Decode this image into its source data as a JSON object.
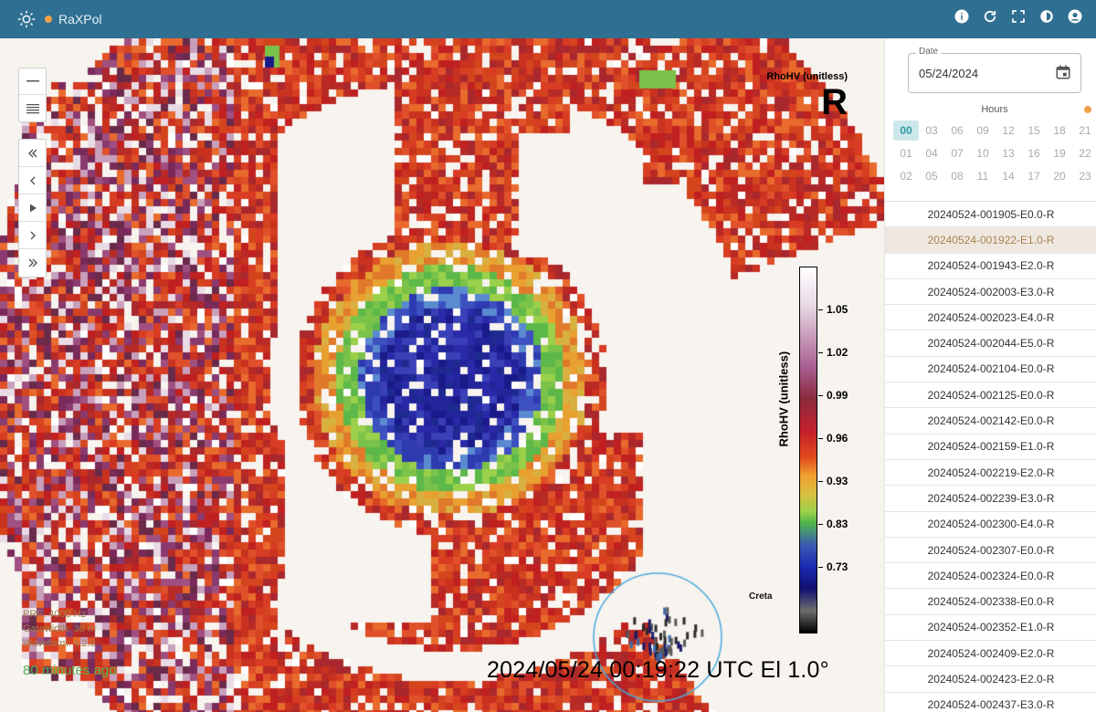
{
  "app": {
    "title": "RaXPol",
    "status_color": "#f0a24a",
    "accent": "#2f6f92",
    "top_actions": [
      "info-icon",
      "refresh-icon",
      "fullscreen-icon",
      "theme-icon",
      "account-icon"
    ]
  },
  "map": {
    "product_name": "RhoHV (unitless)",
    "product_symbol": "R",
    "colorbar_label": "RhoHV (unitless)",
    "colorbar_ticks": [
      "1.05",
      "1.02",
      "0.99",
      "0.96",
      "0.93",
      "0.83",
      "0.73"
    ],
    "site_name": "Creta",
    "prf": "PRF: 4000 Hz",
    "gatewidth": "Gatewidth: 30 m",
    "waveform": "Waveform: s.2.0",
    "age": "80 minutes ago",
    "timestamp": "2024/05/24 00:19:22 UTC  El  1.0°",
    "zoom_controls": [
      "zoom-in",
      "zoom-out"
    ],
    "nav_controls": [
      "first",
      "previous",
      "play",
      "next",
      "last"
    ]
  },
  "sidebar": {
    "date_label": "Date",
    "date_value": "05/24/2024",
    "hours_title": "Hours",
    "hours_dot_color": "#f0a24a",
    "hours": [
      "00",
      "03",
      "06",
      "09",
      "12",
      "15",
      "18",
      "21",
      "01",
      "04",
      "07",
      "10",
      "13",
      "16",
      "19",
      "22",
      "02",
      "05",
      "08",
      "11",
      "14",
      "17",
      "20",
      "23"
    ],
    "active_hour": "00",
    "files": [
      "20240524-001905-E0.0-R",
      "20240524-001922-E1.0-R",
      "20240524-001943-E2.0-R",
      "20240524-002003-E3.0-R",
      "20240524-002023-E4.0-R",
      "20240524-002044-E5.0-R",
      "20240524-002104-E0.0-R",
      "20240524-002125-E0.0-R",
      "20240524-002142-E0.0-R",
      "20240524-002159-E1.0-R",
      "20240524-002219-E2.0-R",
      "20240524-002239-E3.0-R",
      "20240524-002300-E4.0-R",
      "20240524-002307-E0.0-R",
      "20240524-002324-E0.0-R",
      "20240524-002338-E0.0-R",
      "20240524-002352-E1.0-R",
      "20240524-002409-E2.0-R",
      "20240524-002423-E2.0-R",
      "20240524-002437-E3.0-R"
    ],
    "selected_file": "20240524-001922-E1.0-R"
  }
}
